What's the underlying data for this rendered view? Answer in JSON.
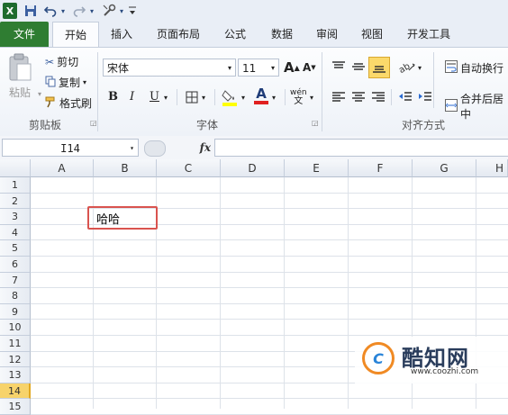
{
  "qat": {
    "app_icon": "excel-icon",
    "buttons": [
      "save-icon",
      "undo-icon",
      "redo-icon",
      "customize-icon"
    ],
    "dropdown_glyph": "▾"
  },
  "tabs": [
    "文件",
    "开始",
    "插入",
    "页面布局",
    "公式",
    "数据",
    "审阅",
    "视图",
    "开发工具"
  ],
  "clipboard": {
    "paste": "粘贴",
    "cut": "剪切",
    "copy": "复制",
    "format_painter": "格式刷",
    "group_label": "剪贴板"
  },
  "font": {
    "name": "宋体",
    "size": "11",
    "grow": "A",
    "shrink": "A",
    "bold": "B",
    "italic": "I",
    "underline": "U",
    "font_color_letter": "A",
    "phonetic": "wén",
    "group_label": "字体",
    "colors": {
      "highlight": "#ffff00",
      "font_color": "#e02020"
    }
  },
  "alignment": {
    "wrap_text": "自动换行",
    "merge_center": "合并后居中",
    "group_label": "对齐方式"
  },
  "formula_bar": {
    "name_box": "I14",
    "fx": "fx",
    "formula": ""
  },
  "sheet": {
    "columns": [
      "A",
      "B",
      "C",
      "D",
      "E",
      "F",
      "G",
      "H"
    ],
    "rows": [
      "1",
      "2",
      "3",
      "4",
      "5",
      "6",
      "7",
      "8",
      "9",
      "10",
      "11",
      "12",
      "13",
      "14",
      "15"
    ],
    "active_row": "14",
    "cells": {
      "B3": "哈哈"
    },
    "highlight_color": "#d9534f"
  },
  "watermark": {
    "brand": "酷知网",
    "url": "www.coozhi.com"
  }
}
